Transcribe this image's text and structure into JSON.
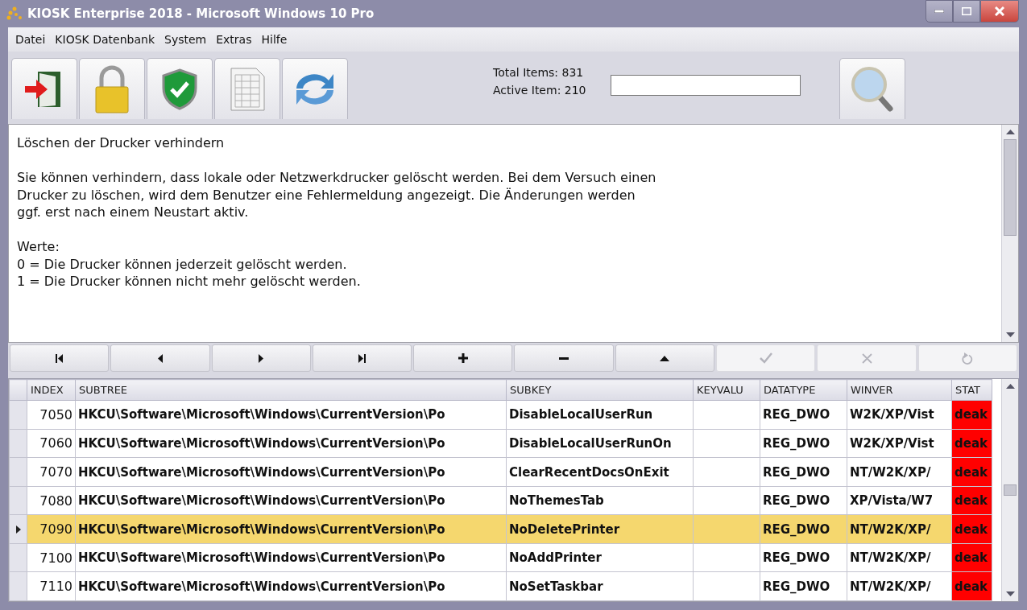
{
  "window": {
    "title": "KIOSK Enterprise 2018 - Microsoft Windows 10 Pro"
  },
  "menu": [
    "Datei",
    "KIOSK Datenbank",
    "System",
    "Extras",
    "Hilfe"
  ],
  "toolbar": [
    {
      "kind": "exit"
    },
    {
      "kind": "lock"
    },
    {
      "kind": "shield"
    },
    {
      "kind": "sheet"
    },
    {
      "kind": "refresh"
    }
  ],
  "counters": {
    "total": "Total Items: 831",
    "active": "Active Item: 210"
  },
  "description": [
    [
      "Löschen der Drucker verhindern"
    ],
    [
      "Sie können verhindern, dass lokale oder Netzwerkdrucker gelöscht werden. Bei dem Versuch einen",
      "Drucker zu löschen, wird dem Benutzer eine Fehlermeldung angezeigt. Die Änderungen werden",
      "ggf. erst nach einem Neustart aktiv."
    ],
    [
      "Werte:",
      "0 = Die Drucker können jederzeit gelöscht werden.",
      "1 = Die Drucker können nicht mehr gelöscht werden."
    ]
  ],
  "navigator": [
    {
      "kind": "first",
      "disabled": false
    },
    {
      "kind": "prior",
      "disabled": false
    },
    {
      "kind": "next",
      "disabled": false
    },
    {
      "kind": "last",
      "disabled": false
    },
    {
      "kind": "insert",
      "disabled": false
    },
    {
      "kind": "delete",
      "disabled": false
    },
    {
      "kind": "edit",
      "disabled": false
    },
    {
      "kind": "post",
      "disabled": true
    },
    {
      "kind": "cancel",
      "disabled": true
    },
    {
      "kind": "refresh",
      "disabled": true
    }
  ],
  "table": {
    "columns": [
      "INDEX",
      "SUBTREE",
      "SUBKEY",
      "KEYVALU",
      "DATATYPE",
      "WINVER",
      "STAT"
    ],
    "rows": [
      {
        "index": "7050",
        "subtree": "HKCU\\Software\\Microsoft\\Windows\\CurrentVersion\\Po",
        "subkey": "DisableLocalUserRun",
        "datatype": "REG_DWO",
        "winver": "W2K/XP/Vist",
        "status": "deak",
        "color": "#ff0000",
        "selected": false
      },
      {
        "index": "7060",
        "subtree": "HKCU\\Software\\Microsoft\\Windows\\CurrentVersion\\Po",
        "subkey": "DisableLocalUserRunOn",
        "datatype": "REG_DWO",
        "winver": "W2K/XP/Vist",
        "status": "deak",
        "color": "#ff0000",
        "selected": false
      },
      {
        "index": "7070",
        "subtree": "HKCU\\Software\\Microsoft\\Windows\\CurrentVersion\\Po",
        "subkey": "ClearRecentDocsOnExit",
        "datatype": "REG_DWO",
        "winver": "NT/W2K/XP/",
        "status": "deak",
        "color": "#ff0000",
        "selected": false
      },
      {
        "index": "7080",
        "subtree": "HKCU\\Software\\Microsoft\\Windows\\CurrentVersion\\Po",
        "subkey": "NoThemesTab",
        "datatype": "REG_DWO",
        "winver": "XP/Vista/W7",
        "status": "deak",
        "color": "#ff0000",
        "selected": false
      },
      {
        "index": "7090",
        "subtree": "HKCU\\Software\\Microsoft\\Windows\\CurrentVersion\\Po",
        "subkey": "NoDeletePrinter",
        "datatype": "REG_DWO",
        "winver": "NT/W2K/XP/",
        "status": "deak",
        "color": "#ff0000",
        "selected": true
      },
      {
        "index": "7100",
        "subtree": "HKCU\\Software\\Microsoft\\Windows\\CurrentVersion\\Po",
        "subkey": "NoAddPrinter",
        "datatype": "REG_DWO",
        "winver": "NT/W2K/XP/",
        "status": "deak",
        "color": "#ff0000",
        "selected": false
      },
      {
        "index": "7110",
        "subtree": "HKCU\\Software\\Microsoft\\Windows\\CurrentVersion\\Po",
        "subkey": "NoSetTaskbar",
        "datatype": "REG_DWO",
        "winver": "NT/W2K/XP/",
        "status": "deak",
        "color": "#ff0000",
        "selected": false
      }
    ]
  }
}
